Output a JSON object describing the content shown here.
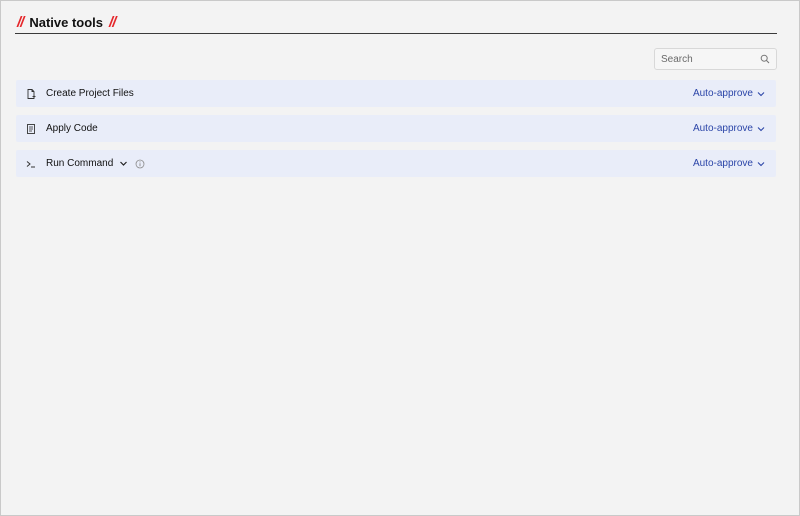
{
  "header": {
    "title": "Native tools",
    "slash_left": "//",
    "slash_right": "//"
  },
  "search": {
    "placeholder": "Search",
    "value": ""
  },
  "tools": [
    {
      "label": "Create Project Files",
      "icon": "new-file-icon",
      "approval": "Auto-approve"
    },
    {
      "label": "Apply Code",
      "icon": "document-icon",
      "approval": "Auto-approve"
    },
    {
      "label": "Run Command",
      "icon": "terminal-icon",
      "approval": "Auto-approve",
      "expandable": true,
      "has_info": true
    }
  ],
  "colors": {
    "accent_red": "#e5262a",
    "row_background": "#e9edf9",
    "link_blue": "#2b45a8",
    "page_background": "#f3f3f3"
  }
}
